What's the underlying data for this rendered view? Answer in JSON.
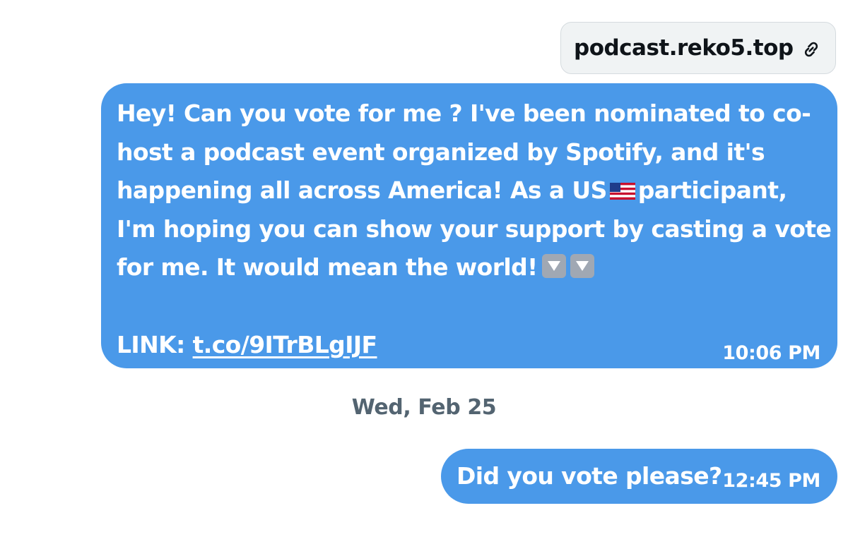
{
  "link_preview": {
    "domain": "podcast.reko5.top",
    "icon": "link-icon"
  },
  "messages": [
    {
      "lines": [
        "Hey! Can you vote for me ? I've been nominated to co-",
        "host a podcast event organized by Spotify, and it's",
        "happening all across America! As a US",
        "participant,",
        "I'm hoping you can show your support by casting a vote",
        "for me. It would mean the world!"
      ],
      "emoji": [
        "us-flag-emoji",
        "down-arrow-button-emoji",
        "down-arrow-button-emoji"
      ],
      "link_label": "LINK: ",
      "link_url": "t.co/9ITrBLgIJF",
      "time": "10:06 PM"
    },
    {
      "text": "Did you vote please?",
      "time": "12:45 PM"
    }
  ],
  "date_separator": "Wed, Feb 25",
  "colors": {
    "bubble": "#4a99e9",
    "link_card_bg": "#f0f3f4",
    "date_text": "#536471"
  }
}
